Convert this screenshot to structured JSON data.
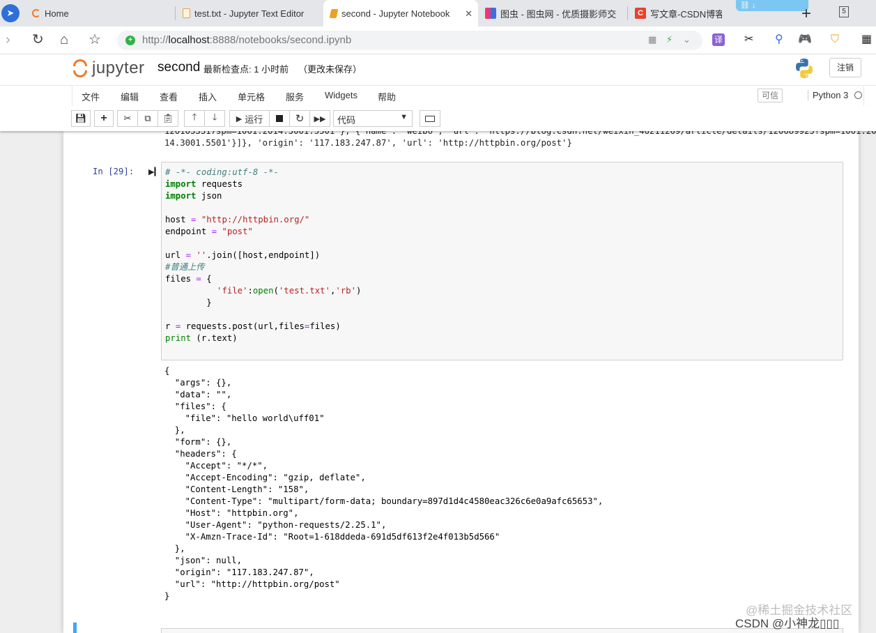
{
  "browser": {
    "tabs": [
      {
        "label": "Home",
        "active": false
      },
      {
        "label": "test.txt - Jupyter Text Editor",
        "active": false
      },
      {
        "label": "second - Jupyter Notebook",
        "active": true
      },
      {
        "label": "图虫 - 图虫网 - 优质摄影师交",
        "active": false
      },
      {
        "label": "写文章-CSDN博客",
        "active": false
      }
    ],
    "tab_count": "5",
    "address_scheme": "http://",
    "address_host": "localhost",
    "address_path": ":8888/notebooks/second.ipynb",
    "translate_label": "译"
  },
  "jupyter": {
    "logo_text": "jupyter",
    "notebook_name": "second",
    "checkpoint": "最新检查点: 1 小时前",
    "unsaved": "（更改未保存）",
    "logout_label": "注销",
    "menu": [
      "文件",
      "编辑",
      "查看",
      "插入",
      "单元格",
      "服务",
      "Widgets",
      "帮助"
    ],
    "trusted_label": "可信",
    "kernel_name": "Python 3",
    "toolbar": {
      "run_label": "运行",
      "cell_type": "代码",
      "icons": [
        "save-icon",
        "plus-icon",
        "cut-icon",
        "copy-icon",
        "paste-icon",
        "arrow-up-icon",
        "arrow-down-icon",
        "run-icon",
        "stop-icon",
        "restart-icon",
        "fast-forward-icon",
        "keyboard-icon"
      ]
    }
  },
  "cell": {
    "previous_output": [
      "1201033317spm=1001.2014.3001.5501'}, {'name': 'weibo', 'url': 'https://blog.csdn.net/weixin_46211269/article/details/120689923?spm=1001.20",
      "14.3001.5501'}]}, 'origin': '117.183.247.87', 'url': 'http://httpbin.org/post'}"
    ],
    "prompt": "In  [29]:",
    "code": [
      "# -*- coding:utf-8 -*-",
      "import requests",
      "import json",
      "",
      "host = \"http://httpbin.org/\"",
      "endpoint = \"post\"",
      "",
      "url = ''.join([host,endpoint])",
      "#普通上传",
      "files = {",
      "          'file':open('test.txt','rb')",
      "        }",
      "",
      "r = requests.post(url,files=files)",
      "print (r.text)"
    ],
    "output": [
      "{",
      "  \"args\": {},",
      "  \"data\": \"\",",
      "  \"files\": {",
      "    \"file\": \"hello world\\uff01\"",
      "  },",
      "  \"form\": {},",
      "  \"headers\": {",
      "    \"Accept\": \"*/*\",",
      "    \"Accept-Encoding\": \"gzip, deflate\",",
      "    \"Content-Length\": \"158\",",
      "    \"Content-Type\": \"multipart/form-data; boundary=897d1d4c4580eac326c6e0a9afc65653\",",
      "    \"Host\": \"httpbin.org\",",
      "    \"User-Agent\": \"python-requests/2.25.1\",",
      "    \"X-Amzn-Trace-Id\": \"Root=1-618ddeda-691d5df613f2e4f013b5d566\"",
      "  },",
      "  \"json\": null,",
      "  \"origin\": \"117.183.247.87\",",
      "  \"url\": \"http://httpbin.org/post\"",
      "}"
    ]
  },
  "watermarks": [
    "@稀土掘金技术社区",
    "CSDN @小神龙▯▯▯"
  ]
}
